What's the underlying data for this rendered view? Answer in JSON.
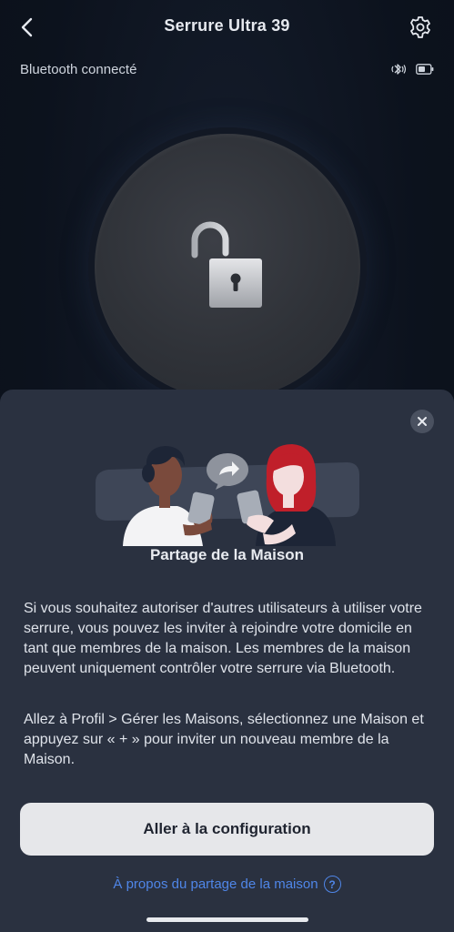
{
  "header": {
    "title": "Serrure Ultra 39",
    "back_icon": "chevron-left-icon",
    "settings_icon": "gear-icon"
  },
  "status": {
    "connection_text": "Bluetooth connecté",
    "bluetooth_icon": "bluetooth-icon",
    "battery_icon": "battery-icon"
  },
  "lock": {
    "state_icon": "padlock-open-icon"
  },
  "sheet": {
    "close_icon": "close-icon",
    "title": "Partage de la Maison",
    "paragraph1": "Si vous souhaitez autoriser d'autres utilisateurs à utiliser votre serrure, vous pouvez les inviter à rejoindre votre domicile en tant que membres de la maison. Les membres de la maison peuvent uniquement contrôler votre serrure via Bluetooth.",
    "paragraph2": "Allez à Profil > Gérer les Maisons, sélectionnez une Maison et appuyez sur « + » pour inviter un nouveau membre de la Maison.",
    "primary_button": "Aller à la configuration",
    "link_text": "À propos du partage de la maison",
    "help_icon_glyph": "?"
  },
  "colors": {
    "background": "#0f1624",
    "sheet": "#2a3140",
    "link": "#4f86e8",
    "button": "#e6e7ea"
  }
}
